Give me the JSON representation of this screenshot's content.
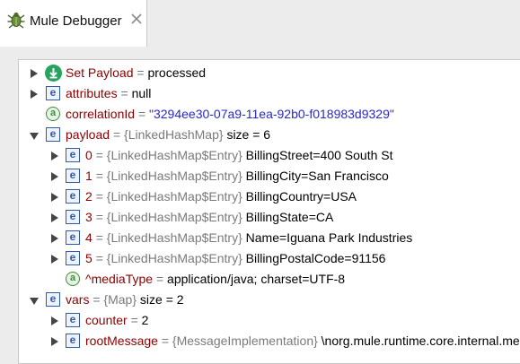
{
  "tab": {
    "title": "Mule Debugger",
    "icon": "bug-icon",
    "close_icon": "close-icon"
  },
  "rows": [
    {
      "name": "Set Payload",
      "eq": "=",
      "type": "",
      "value": "processed",
      "icon": "download-circle-icon",
      "expander": "collapsed"
    },
    {
      "name": "attributes",
      "eq": "=",
      "type": "",
      "value": "null",
      "icon": "e",
      "expander": "collapsed"
    },
    {
      "name": "correlationId",
      "eq": "=",
      "type": "",
      "value": "\"3294ee30-07a9-11ea-92b0-f018983d9329\"",
      "icon": "a",
      "expander": "none"
    },
    {
      "name": "payload",
      "eq": "=",
      "type": "{LinkedHashMap}",
      "value": "size = 6",
      "icon": "e",
      "expander": "expanded"
    },
    {
      "name": "0",
      "eq": "=",
      "type": "{LinkedHashMap$Entry}",
      "value": "BillingStreet=400 South St",
      "icon": "e",
      "expander": "collapsed"
    },
    {
      "name": "1",
      "eq": "=",
      "type": "{LinkedHashMap$Entry}",
      "value": "BillingCity=San Francisco",
      "icon": "e",
      "expander": "collapsed"
    },
    {
      "name": "2",
      "eq": "=",
      "type": "{LinkedHashMap$Entry}",
      "value": "BillingCountry=USA",
      "icon": "e",
      "expander": "collapsed"
    },
    {
      "name": "3",
      "eq": "=",
      "type": "{LinkedHashMap$Entry}",
      "value": "BillingState=CA",
      "icon": "e",
      "expander": "collapsed"
    },
    {
      "name": "4",
      "eq": "=",
      "type": "{LinkedHashMap$Entry}",
      "value": "Name=Iguana Park Industries",
      "icon": "e",
      "expander": "collapsed"
    },
    {
      "name": "5",
      "eq": "=",
      "type": "{LinkedHashMap$Entry}",
      "value": "BillingPostalCode=91156",
      "icon": "e",
      "expander": "collapsed"
    },
    {
      "name": "^mediaType",
      "eq": "=",
      "type": "",
      "value": "application/java; charset=UTF-8",
      "icon": "a",
      "expander": "none"
    },
    {
      "name": "vars",
      "eq": "=",
      "type": "{Map}",
      "value": "size = 2",
      "icon": "e",
      "expander": "expanded"
    },
    {
      "name": "counter",
      "eq": "=",
      "type": "",
      "value": "2",
      "icon": "e",
      "expander": "collapsed"
    },
    {
      "name": "rootMessage",
      "eq": "=",
      "type": "{MessageImplementation}",
      "value": "\\norg.mule.runtime.core.internal.message.DefaultMessageBuilder",
      "icon": "e",
      "expander": "collapsed"
    }
  ],
  "colors": {
    "name": "#8b0000",
    "type": "#7a7a7a",
    "string": "#2a27c9",
    "icon_e": "#2e5aa7",
    "icon_a": "#3f8b3f",
    "icon_set": "#27a35d"
  }
}
